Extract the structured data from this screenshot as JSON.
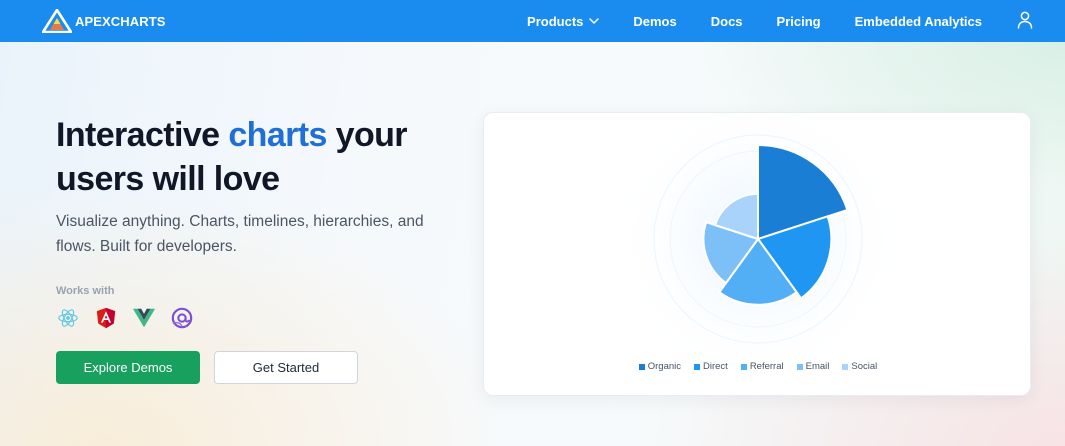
{
  "nav": {
    "logo_text": "APEXCHARTS",
    "links": [
      {
        "label": "Products",
        "has_dropdown": true
      },
      {
        "label": "Demos"
      },
      {
        "label": "Docs"
      },
      {
        "label": "Pricing"
      },
      {
        "label": "Embedded Analytics"
      }
    ],
    "user_icon": "user-icon"
  },
  "hero": {
    "title_part1": "Interactive ",
    "title_accent": "charts",
    "title_part2": " your users will love",
    "subtitle": "Visualize anything. Charts, timelines, hierarchies, and flows. Built for developers.",
    "works_with_label": "Works with",
    "frameworks": [
      "react-icon",
      "angular-icon",
      "vue-icon",
      "blazor-icon"
    ],
    "primary_button": "Explore Demos",
    "secondary_button": "Get Started"
  },
  "colors": {
    "nav_bg": "#1a8cf0",
    "accent_text": "#1f6fd6",
    "primary_button": "#18a05e"
  },
  "chart_data": {
    "type": "polarArea",
    "categories": [
      "Organic",
      "Direct",
      "Referral",
      "Email",
      "Social"
    ],
    "values": [
      100,
      78,
      70,
      58,
      48
    ],
    "colors": [
      "#1a7fd4",
      "#1f97f2",
      "#52aef5",
      "#7dc0f7",
      "#a9d3fa"
    ],
    "legend_position": "bottom"
  }
}
